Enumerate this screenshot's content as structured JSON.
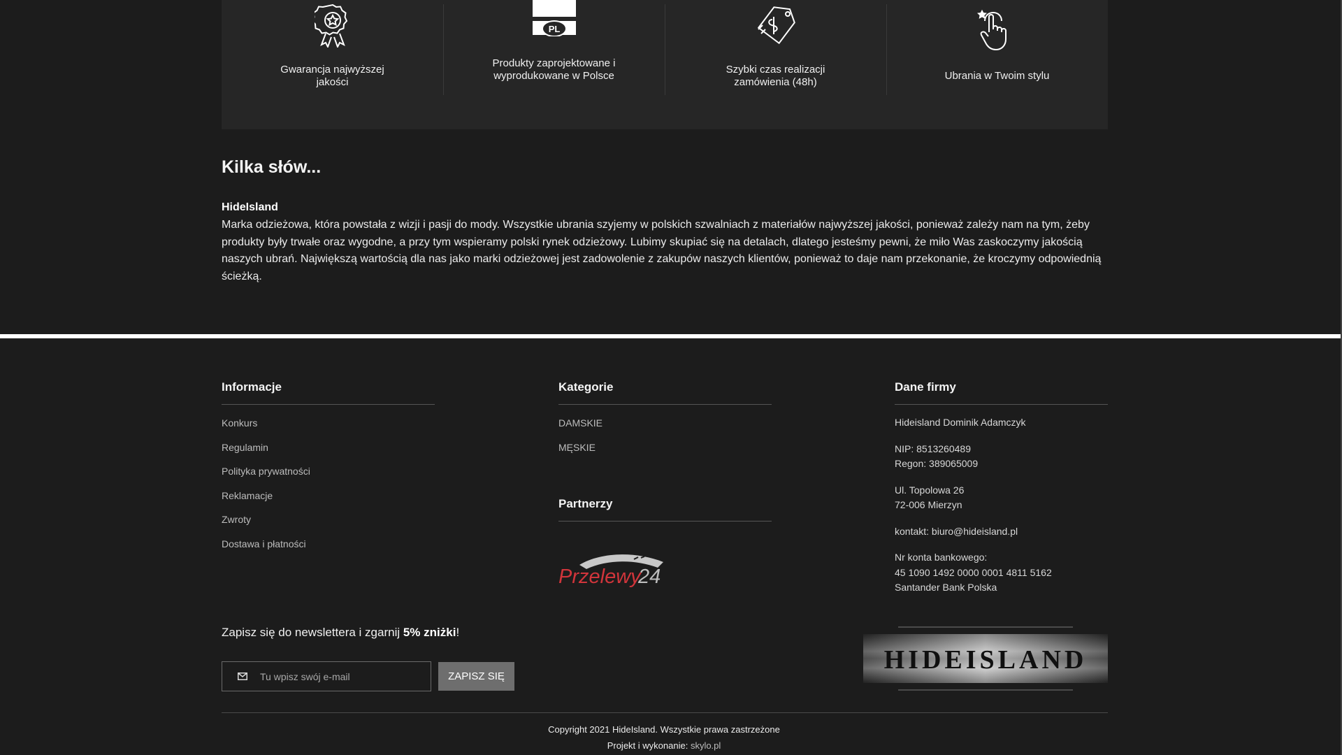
{
  "features": [
    {
      "icon": "award-badge-icon",
      "text": "Gwarancja najwyższej jakości"
    },
    {
      "icon": "pl-flag-icon",
      "flag_label": "PL",
      "text": "Produkty zaprojektowane i wyprodukowane w Polsce"
    },
    {
      "icon": "price-tag-icon",
      "text": "Szybki czas realizacji zamówienia (48h)"
    },
    {
      "icon": "hand-pointer-icon",
      "text": "Ubrania w Twoim stylu"
    }
  ],
  "about": {
    "title": "Kilka słów...",
    "brand": "HideIsland",
    "text": "Marka odzieżowa, która powstała z wizji i pasji do mody. Wszystkie ubrania szyjemy w polskich szwalniach z materiałów najwyższej jakości, ponieważ zależy nam na tym, żeby produkty były trwałe oraz wygodne, a przy tym wspieramy polski rynek odzieżowy. Lubimy skupiać się na detalach, dlatego jesteśmy pewni, że miło Was zaskoczymy jakością naszych ubrań. Największą wartością dla nas jako marki odzieżowej jest zadowolenie z zakupów naszych klientów, ponieważ to daje nam przekonanie, że kroczymy odpowiednią ścieżką."
  },
  "footer": {
    "info": {
      "title": "Informacje",
      "links": [
        "Konkurs",
        "Regulamin",
        "Polityka prywatności",
        "Reklamacje",
        "Zwroty",
        "Dostawa i płatności"
      ]
    },
    "categories": {
      "title": "Kategorie",
      "links": [
        "DAMSKIE",
        "MĘSKIE"
      ]
    },
    "partners": {
      "title": "Partnerzy",
      "logo_text": "Przelewy",
      "logo_number": "24"
    },
    "company": {
      "title": "Dane firmy",
      "name": "Hideisland Dominik Adamczyk",
      "nip": "NIP: 8513260489",
      "regon": "Regon: 389065009",
      "street": "Ul. Topolowa 26",
      "city": "72-006 Mierzyn",
      "contact": "kontakt: biuro@hideisland.pl",
      "bank_label": "Nr konta bankowego:",
      "bank_number": "45 1090 1492 0000 0001 4811 5162",
      "bank_name": "Santander Bank Polska"
    },
    "newsletter": {
      "title_prefix": "Zapisz się do newslettera i zgarnij ",
      "title_bold": "5% zniżki",
      "title_suffix": "!",
      "placeholder": "Tu wpisz swój e-mail",
      "button": "ZAPISZ SIĘ"
    },
    "brand_logo": "HIDEISLAND",
    "copyright": "Copyright 2021 HideIsland. Wszystkie prawa zastrzeżone",
    "credit_label": "Projekt i wykonanie: ",
    "credit_link": "skylo.pl"
  }
}
